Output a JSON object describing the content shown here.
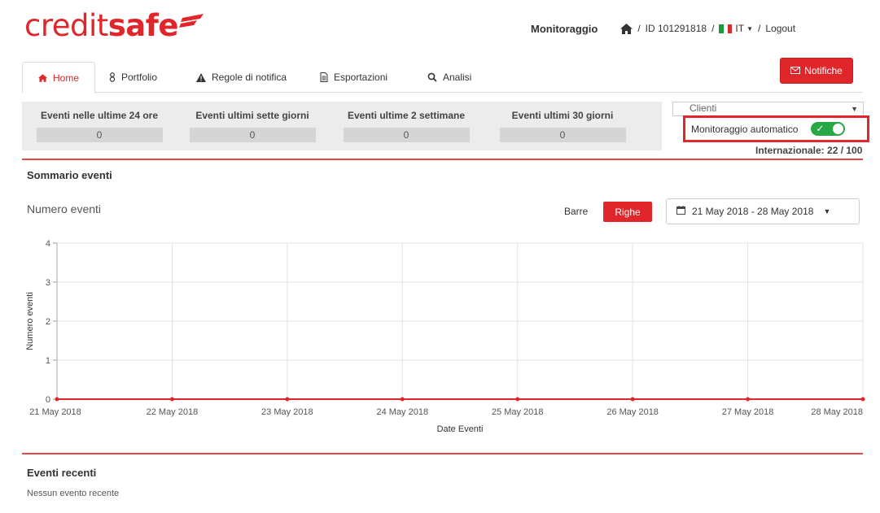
{
  "brand": {
    "logo_light": "credit",
    "logo_bold": "safe",
    "color": "#e0262b"
  },
  "topnav": {
    "section": "Monitoraggio",
    "id_label": "ID 101291818",
    "language": "IT",
    "logout": "Logout",
    "separator": "/"
  },
  "tabs": [
    {
      "label": "Home",
      "icon": "home-icon",
      "active": true
    },
    {
      "label": "Portfolio",
      "icon": "portfolio-icon",
      "active": false
    },
    {
      "label": "Regole di notifica",
      "icon": "warning-icon",
      "active": false
    },
    {
      "label": "Esportazioni",
      "icon": "document-icon",
      "active": false
    },
    {
      "label": "Analisi",
      "icon": "search-icon",
      "active": false
    }
  ],
  "notifications_button": {
    "label": "Notifiche",
    "icon": "envelope-icon"
  },
  "stats": [
    {
      "label": "Eventi nelle ultime 24 ore",
      "value": "0"
    },
    {
      "label": "Eventi ultimi sette giorni",
      "value": "0"
    },
    {
      "label": "Eventi ultime 2 settimane",
      "value": "0"
    },
    {
      "label": "Eventi ultimi 30 giorni",
      "value": "0"
    }
  ],
  "clienti_select": {
    "selected": "Clienti"
  },
  "auto_monitoring": {
    "label": "Monitoraggio automatico",
    "enabled": true,
    "color": "#27a745"
  },
  "international": "Internazionale: 22 / 100",
  "summary": {
    "title": "Sommario eventi",
    "chart_title": "Numero eventi",
    "view_bars": "Barre",
    "view_lines": "Righe",
    "date_range": "21 May 2018 - 28 May 2018"
  },
  "chart_data": {
    "type": "line",
    "x": [
      "21 May 2018",
      "22 May 2018",
      "23 May 2018",
      "24 May 2018",
      "25 May 2018",
      "26 May 2018",
      "27 May 2018",
      "28 May 2018"
    ],
    "series": [
      {
        "values": [
          0,
          0,
          0,
          0,
          0,
          0,
          0,
          0
        ],
        "color": "#e0262b"
      }
    ],
    "xlabel": "Date Eventi",
    "ylabel": "Numero eventi",
    "ylim": [
      0,
      4
    ],
    "yticks": [
      "0",
      "1",
      "2",
      "3",
      "4"
    ],
    "grid": true
  },
  "recent": {
    "title": "Eventi recenti",
    "empty": "Nessun evento recente"
  }
}
